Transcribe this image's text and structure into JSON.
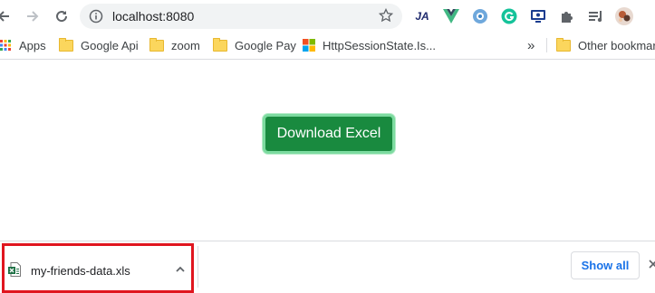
{
  "browser": {
    "url": "localhost:8080",
    "bookmarks": [
      {
        "label": "Apps"
      },
      {
        "label": "Google Api"
      },
      {
        "label": "zoom"
      },
      {
        "label": "Google Pay"
      },
      {
        "label": "HttpSessionState.Is..."
      }
    ],
    "overflow_symbol": "»",
    "other_bookmarks": "Other bookmarks",
    "extension_labels": {
      "ja": "JA"
    }
  },
  "page": {
    "download_button": "Download Excel",
    "accent_color": "#198a3f"
  },
  "download_shelf": {
    "file_name": "my-friends-data.xls",
    "show_all": "Show all",
    "highlight_color": "#e0161f"
  }
}
